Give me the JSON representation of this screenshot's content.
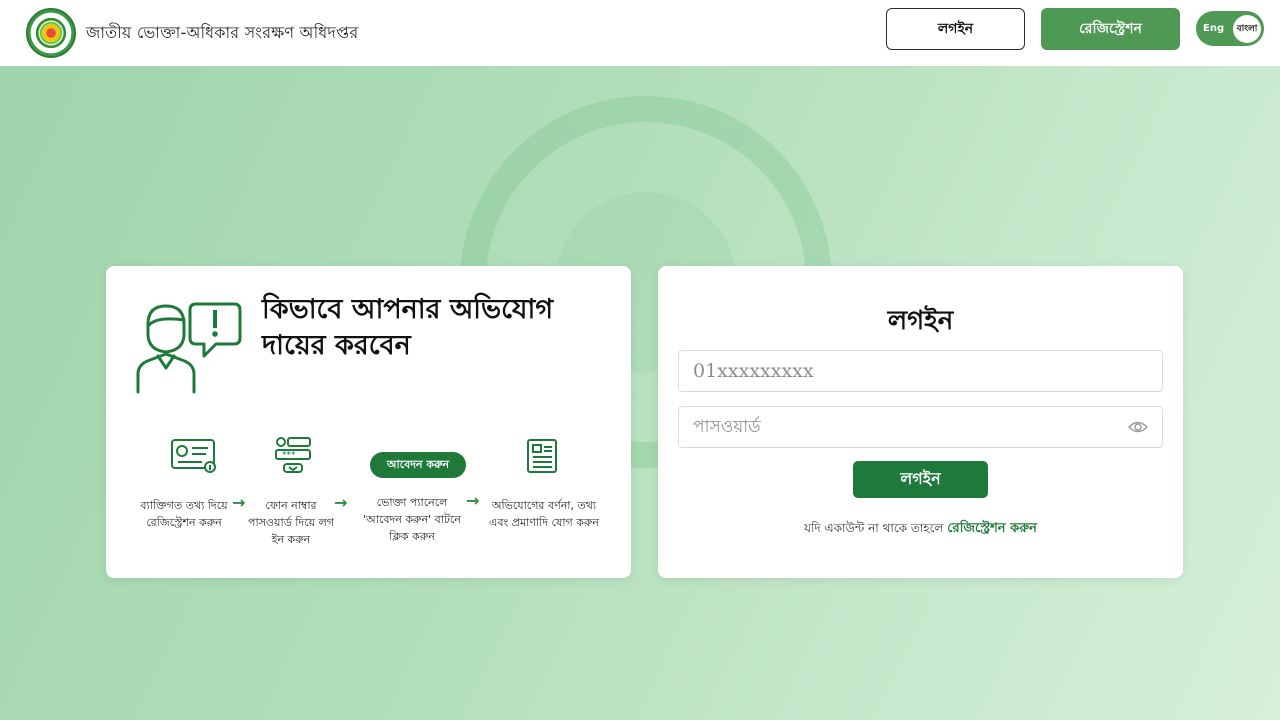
{
  "header": {
    "site_title": "জাতীয় ভোক্তা-অধিকার সংরক্ষণ অধিদপ্তর",
    "login_label": "লগইন",
    "register_label": "রেজিস্ট্রেশন",
    "lang_eng": "Eng",
    "lang_bn": "বাংলা"
  },
  "info": {
    "title": "কিভাবে আপনার অভিযোগ দায়ের করবেন",
    "apply_pill": "আবেদন করুন",
    "steps": [
      {
        "text": "ব্যাক্তিগত তথ্য দিয়ে রেজিস্ট্রেশন করুন"
      },
      {
        "text": "ফোন নাম্বার পাসওয়ার্ড দিয়ে লগ ইন করুন"
      },
      {
        "text": "ভোক্তা প্যানেলে 'আবেদন করুন' বাটনে ক্লিক করুন"
      },
      {
        "text": "অভিযোগের বর্ণনা, তথ্য এবং প্রমাণাদি যোগ করুন"
      }
    ],
    "arrow": "→"
  },
  "login": {
    "heading": "লগইন",
    "phone_placeholder": "01xxxxxxxxx",
    "password_placeholder": "পাসওয়ার্ড",
    "submit_label": "লগইন",
    "no_account_text": "যদি একাউন্ট না থাকে তাহলে",
    "register_link": "রেজিস্ট্রেশন করুন"
  },
  "colors": {
    "brand_green": "#1e7a3a",
    "button_green": "#4e9a55",
    "background": "#b3dfbc"
  }
}
